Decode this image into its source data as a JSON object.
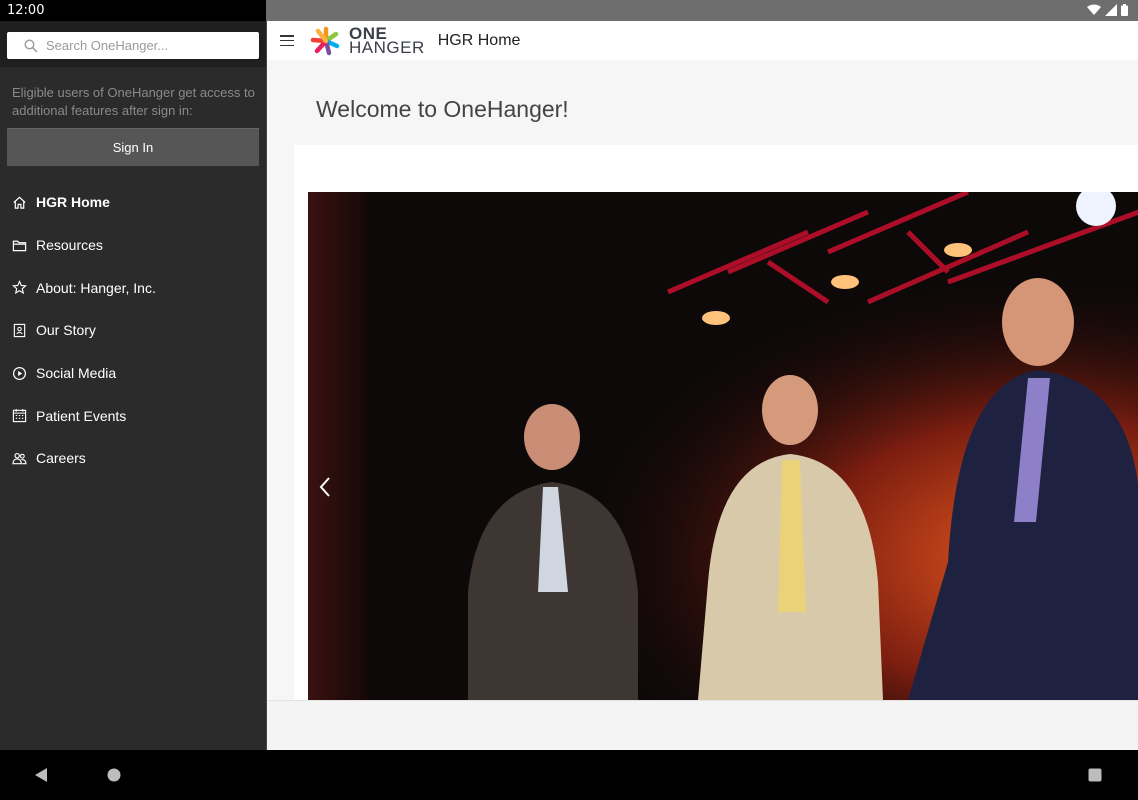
{
  "status": {
    "time": "12:00"
  },
  "drawer": {
    "search_placeholder": "Search OneHanger...",
    "signin_hint": "Eligible users of OneHanger get access to additional features after sign in:",
    "signin_label": "Sign In",
    "items": [
      {
        "label": "HGR Home",
        "icon": "home-icon",
        "active": true
      },
      {
        "label": "Resources",
        "icon": "folder-icon"
      },
      {
        "label": "About: Hanger, Inc.",
        "icon": "star-icon"
      },
      {
        "label": "Our Story",
        "icon": "contact-book-icon"
      },
      {
        "label": "Social Media",
        "icon": "play-circle-icon"
      },
      {
        "label": "Patient Events",
        "icon": "calendar-icon"
      },
      {
        "label": "Careers",
        "icon": "people-icon"
      }
    ]
  },
  "header": {
    "logo_one": "ONE",
    "logo_hanger": "HANGER",
    "title": "HGR Home"
  },
  "main": {
    "heading": "Welcome to OneHanger!"
  },
  "colors": {
    "drawer_bg": "#2b2b2b",
    "signin_bg": "#565656",
    "accent_red": "#e23a3a"
  }
}
